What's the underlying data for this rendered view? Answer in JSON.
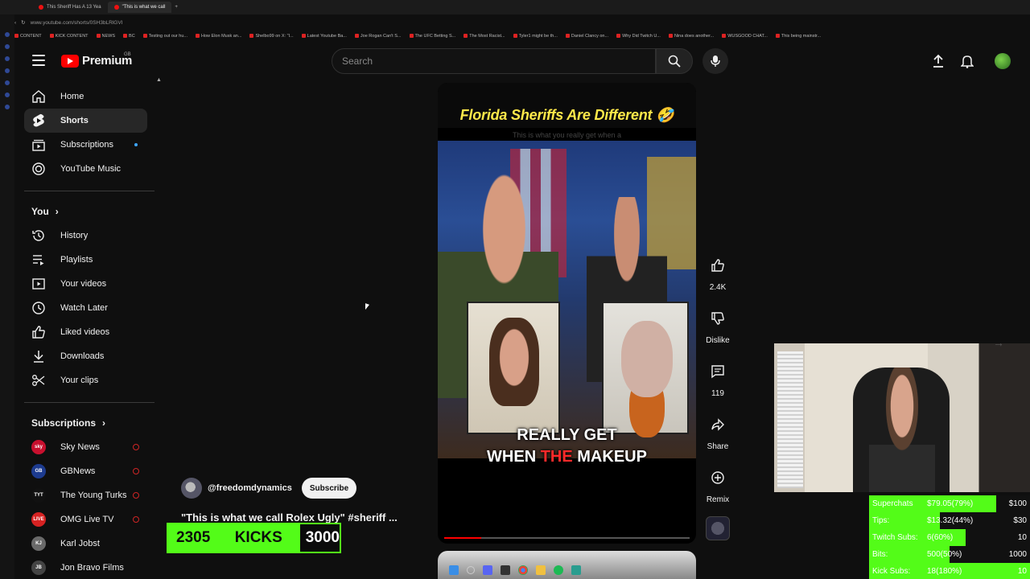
{
  "browser": {
    "tabs": [
      {
        "label": "This Sheriff Has A 13 Yea",
        "active": false
      },
      {
        "label": "\"This is what we call",
        "active": true
      }
    ],
    "url": "www.youtube.com/shorts/0SH3bLRlGVI",
    "bookmarks": [
      "CONTENT",
      "KICK CONTENT",
      "NEWS",
      "BC",
      "Testing out our hu...",
      "How Elon Musk an...",
      "Shelbo99 on X: \"I...",
      "Latest Youtube Ba...",
      "Joe Rogan Can't S...",
      "The UFC Betting S...",
      "The Most Racist...",
      "Tyler1 might be th...",
      "Daniel Clancy on...",
      "Why Did Twitch U...",
      "Nina does another...",
      "WUSGOOD CHAT...",
      "This being mainstr..."
    ]
  },
  "header": {
    "logo_text": "Premium",
    "region": "GB",
    "search_placeholder": "Search",
    "icons": [
      "menu-icon",
      "search-icon",
      "mic-icon",
      "upload-icon",
      "bell-icon"
    ]
  },
  "sidebar": {
    "main": [
      {
        "label": "Home",
        "icon": "home-icon",
        "active": false
      },
      {
        "label": "Shorts",
        "icon": "shorts-icon",
        "active": true
      },
      {
        "label": "Subscriptions",
        "icon": "subscriptions-icon",
        "active": false,
        "new": true
      },
      {
        "label": "YouTube Music",
        "icon": "music-icon",
        "active": false
      }
    ],
    "you_title": "You",
    "you": [
      {
        "label": "History",
        "icon": "history-icon"
      },
      {
        "label": "Playlists",
        "icon": "playlists-icon"
      },
      {
        "label": "Your videos",
        "icon": "your-videos-icon"
      },
      {
        "label": "Watch Later",
        "icon": "clock-icon"
      },
      {
        "label": "Liked videos",
        "icon": "thumb-up-icon"
      },
      {
        "label": "Downloads",
        "icon": "download-icon"
      },
      {
        "label": "Your clips",
        "icon": "scissors-icon"
      }
    ],
    "subs_title": "Subscriptions",
    "subscriptions": [
      {
        "label": "Sky News",
        "abbr": "sky",
        "color": "#c8102e",
        "live": true
      },
      {
        "label": "GBNews",
        "abbr": "GB",
        "color": "#1d3b8f",
        "live": true
      },
      {
        "label": "The Young Turks",
        "abbr": "TYT",
        "color": "#111111",
        "live": true
      },
      {
        "label": "OMG Live TV",
        "abbr": "LIVE",
        "color": "#d62222",
        "live": true
      },
      {
        "label": "Karl Jobst",
        "abbr": "KJ",
        "color": "#6a6a6a",
        "live": false
      },
      {
        "label": "Jon Bravo Films",
        "abbr": "JB",
        "color": "#444444",
        "live": false
      }
    ]
  },
  "short": {
    "title_overlay": "Florida Sheriffs Are Different 🤣",
    "subtitle_overlay": "This is what you really get when a",
    "caption_line1": "REALLY GET",
    "caption_hl": "THE",
    "caption_line2_before": "WHEN ",
    "caption_line2_after": " MAKEUP",
    "progress": 0.15,
    "channel": "@freedomdynamics",
    "subscribe_label": "Subscribe",
    "title": "\"This is what we call Rolex Ugly\" #sheriff ..."
  },
  "actions": {
    "like_count": "2.4K",
    "dislike_label": "Dislike",
    "comments_count": "119",
    "share_label": "Share",
    "remix_label": "Remix"
  },
  "kicks": {
    "current": "2305",
    "label": "KICKS",
    "goal": "3000",
    "progress": 0.768
  },
  "donations": [
    {
      "label": "Superchats",
      "current": "$79.05(79%)",
      "goal": "$100",
      "progress": 0.79
    },
    {
      "label": "Tips:",
      "current": "$13.32(44%)",
      "goal": "$30",
      "progress": 0.44
    },
    {
      "label": "Twitch Subs:",
      "current": "6(60%)",
      "goal": "10",
      "progress": 0.6
    },
    {
      "label": "Bits:",
      "current": "500(50%)",
      "goal": "1000",
      "progress": 0.5
    },
    {
      "label": "Kick Subs:",
      "current": "18(180%)",
      "goal": "10",
      "progress": 1.0
    }
  ],
  "colors": {
    "kick_green": "#53fc18",
    "youtube_red": "#ff0000",
    "caption_highlight": "#ff2a2a",
    "title_yellow": "#ffe94a"
  }
}
